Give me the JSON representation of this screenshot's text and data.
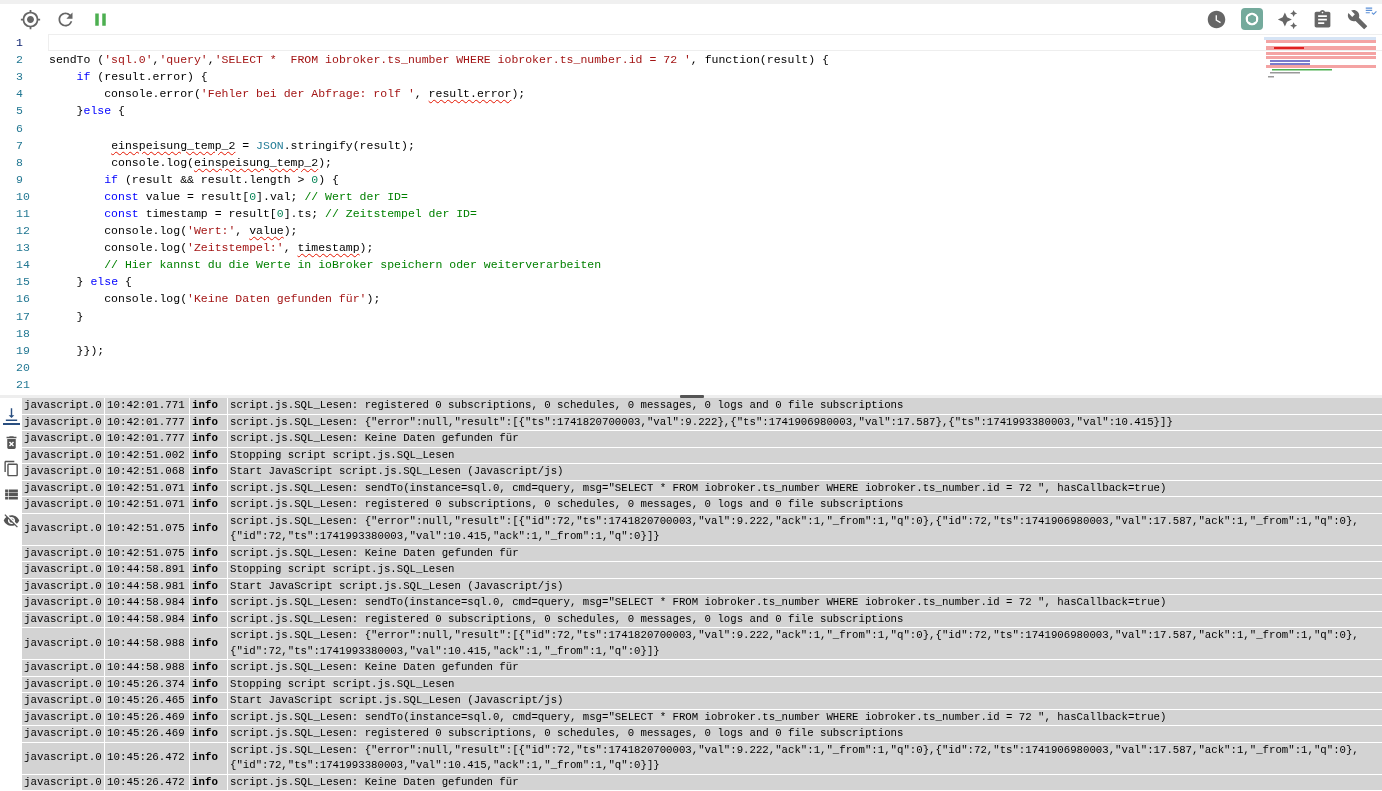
{
  "editor": {
    "lines": [
      {
        "number": "1",
        "current": true
      },
      {
        "number": "2",
        "current": false,
        "tokens": [
          {
            "kind": "plain",
            "text": "sendTo ("
          },
          {
            "kind": "str",
            "text": "'sql.0'"
          },
          {
            "kind": "plain",
            "text": ","
          },
          {
            "kind": "str",
            "text": "'query'"
          },
          {
            "kind": "plain",
            "text": ","
          },
          {
            "kind": "str",
            "text": "'SELECT *  FROM iobroker.ts_number WHERE iobroker.ts_number.id = 72 '"
          },
          {
            "kind": "plain",
            "text": ", function(result) {"
          }
        ]
      },
      {
        "number": "3",
        "current": false,
        "tokens": [
          {
            "kind": "kw",
            "text": "    if"
          },
          {
            "kind": "plain",
            "text": " (result.error) {"
          }
        ]
      },
      {
        "number": "4",
        "current": false,
        "tokens": [
          {
            "kind": "plain",
            "text": "        console.error("
          },
          {
            "kind": "str",
            "text": "'Fehler bei der Abfrage: rolf '"
          },
          {
            "kind": "plain",
            "text": ", "
          },
          {
            "kind": "plain",
            "text": "result.error",
            "misspelled": true
          },
          {
            "kind": "plain",
            "text": ");"
          }
        ]
      },
      {
        "number": "5",
        "current": false,
        "tokens": [
          {
            "kind": "plain",
            "text": "    }"
          },
          {
            "kind": "kw",
            "text": "else"
          },
          {
            "kind": "plain",
            "text": " {"
          }
        ]
      },
      {
        "number": "6",
        "current": false
      },
      {
        "number": "7",
        "current": false,
        "tokens": [
          {
            "kind": "plain",
            "text": "         einspeisung_temp_2",
            "misspelled": true
          },
          {
            "kind": "plain",
            "text": " = "
          },
          {
            "kind": "builtin",
            "text": "JSON"
          },
          {
            "kind": "plain",
            "text": ".stringify(result);"
          }
        ]
      },
      {
        "number": "8",
        "current": false,
        "tokens": [
          {
            "kind": "plain",
            "text": "         console.log("
          },
          {
            "kind": "plain",
            "text": "einspeisung_temp_2",
            "misspelled": true
          },
          {
            "kind": "plain",
            "text": ");"
          }
        ]
      },
      {
        "number": "9",
        "current": false,
        "tokens": [
          {
            "kind": "kw",
            "text": "        if"
          },
          {
            "kind": "plain",
            "text": " (result && result.length > "
          },
          {
            "kind": "num",
            "text": "0"
          },
          {
            "kind": "plain",
            "text": ") {"
          }
        ]
      },
      {
        "number": "10",
        "current": false,
        "tokens": [
          {
            "kind": "kw",
            "text": "        const"
          },
          {
            "kind": "plain",
            "text": " value = result["
          },
          {
            "kind": "num",
            "text": "0"
          },
          {
            "kind": "plain",
            "text": "].val; "
          },
          {
            "kind": "comment",
            "text": "// Wert der ID="
          }
        ]
      },
      {
        "number": "11",
        "current": false,
        "tokens": [
          {
            "kind": "kw",
            "text": "        const"
          },
          {
            "kind": "plain",
            "text": " timestamp = result["
          },
          {
            "kind": "num",
            "text": "0"
          },
          {
            "kind": "plain",
            "text": "].ts; "
          },
          {
            "kind": "comment",
            "text": "// Zeitstempel der ID="
          }
        ]
      },
      {
        "number": "12",
        "current": false,
        "tokens": [
          {
            "kind": "plain",
            "text": "        console.log("
          },
          {
            "kind": "str",
            "text": "'Wert:'"
          },
          {
            "kind": "plain",
            "text": ", "
          },
          {
            "kind": "plain",
            "text": "value",
            "misspelled": true
          },
          {
            "kind": "plain",
            "text": ");"
          }
        ]
      },
      {
        "number": "13",
        "current": false,
        "tokens": [
          {
            "kind": "plain",
            "text": "        console.log("
          },
          {
            "kind": "str",
            "text": "'Zeitstempel:'"
          },
          {
            "kind": "plain",
            "text": ", "
          },
          {
            "kind": "plain",
            "text": "timestamp",
            "misspelled": true
          },
          {
            "kind": "plain",
            "text": ");"
          }
        ]
      },
      {
        "number": "14",
        "current": false,
        "tokens": [
          {
            "kind": "comment",
            "text": "        // Hier kannst du die Werte in ioBroker speichern oder weiterverarbeiten"
          }
        ]
      },
      {
        "number": "15",
        "current": false,
        "tokens": [
          {
            "kind": "plain",
            "text": "    } "
          },
          {
            "kind": "kw",
            "text": "else"
          },
          {
            "kind": "plain",
            "text": " {"
          }
        ]
      },
      {
        "number": "16",
        "current": false,
        "tokens": [
          {
            "kind": "plain",
            "text": "        console.log("
          },
          {
            "kind": "str",
            "text": "'Keine Daten gefunden für'"
          },
          {
            "kind": "plain",
            "text": ");"
          }
        ]
      },
      {
        "number": "17",
        "current": false,
        "tokens": [
          {
            "kind": "plain",
            "text": "    }"
          }
        ]
      },
      {
        "number": "18",
        "current": false
      },
      {
        "number": "19",
        "current": false,
        "tokens": [
          {
            "kind": "plain",
            "text": "    }});"
          }
        ]
      },
      {
        "number": "20",
        "current": false
      },
      {
        "number": "21",
        "current": false
      }
    ]
  },
  "log": {
    "rows": [
      {
        "source": "javascript.0",
        "time": "10:42:01.771",
        "level": "info",
        "message": "script.js.SQL_Lesen: registered 0 subscriptions, 0 schedules, 0 messages, 0 logs and 0 file subscriptions"
      },
      {
        "source": "javascript.0",
        "time": "10:42:01.777",
        "level": "info",
        "message": "script.js.SQL_Lesen: {\"error\":null,\"result\":[{\"ts\":1741820700003,\"val\":9.222},{\"ts\":1741906980003,\"val\":17.587},{\"ts\":1741993380003,\"val\":10.415}]}"
      },
      {
        "source": "javascript.0",
        "time": "10:42:01.777",
        "level": "info",
        "message": "script.js.SQL_Lesen: Keine Daten gefunden für"
      },
      {
        "source": "javascript.0",
        "time": "10:42:51.002",
        "level": "info",
        "message": "Stopping script script.js.SQL_Lesen"
      },
      {
        "source": "javascript.0",
        "time": "10:42:51.068",
        "level": "info",
        "message": "Start JavaScript script.js.SQL_Lesen (Javascript/js)"
      },
      {
        "source": "javascript.0",
        "time": "10:42:51.071",
        "level": "info",
        "message": "script.js.SQL_Lesen: sendTo(instance=sql.0, cmd=query, msg=\"SELECT * FROM iobroker.ts_number WHERE iobroker.ts_number.id = 72 \", hasCallback=true)"
      },
      {
        "source": "javascript.0",
        "time": "10:42:51.071",
        "level": "info",
        "message": "script.js.SQL_Lesen: registered 0 subscriptions, 0 schedules, 0 messages, 0 logs and 0 file subscriptions"
      },
      {
        "source": "javascript.0",
        "time": "10:42:51.075",
        "level": "info",
        "message": "script.js.SQL_Lesen: {\"error\":null,\"result\":[{\"id\":72,\"ts\":1741820700003,\"val\":9.222,\"ack\":1,\"_from\":1,\"q\":0},{\"id\":72,\"ts\":1741906980003,\"val\":17.587,\"ack\":1,\"_from\":1,\"q\":0},{\"id\":72,\"ts\":1741993380003,\"val\":10.415,\"ack\":1,\"_from\":1,\"q\":0}]}"
      },
      {
        "source": "javascript.0",
        "time": "10:42:51.075",
        "level": "info",
        "message": "script.js.SQL_Lesen: Keine Daten gefunden für"
      },
      {
        "source": "javascript.0",
        "time": "10:44:58.891",
        "level": "info",
        "message": "Stopping script script.js.SQL_Lesen"
      },
      {
        "source": "javascript.0",
        "time": "10:44:58.981",
        "level": "info",
        "message": "Start JavaScript script.js.SQL_Lesen (Javascript/js)"
      },
      {
        "source": "javascript.0",
        "time": "10:44:58.984",
        "level": "info",
        "message": "script.js.SQL_Lesen: sendTo(instance=sql.0, cmd=query, msg=\"SELECT * FROM iobroker.ts_number WHERE iobroker.ts_number.id = 72 \", hasCallback=true)"
      },
      {
        "source": "javascript.0",
        "time": "10:44:58.984",
        "level": "info",
        "message": "script.js.SQL_Lesen: registered 0 subscriptions, 0 schedules, 0 messages, 0 logs and 0 file subscriptions"
      },
      {
        "source": "javascript.0",
        "time": "10:44:58.988",
        "level": "info",
        "message": "script.js.SQL_Lesen: {\"error\":null,\"result\":[{\"id\":72,\"ts\":1741820700003,\"val\":9.222,\"ack\":1,\"_from\":1,\"q\":0},{\"id\":72,\"ts\":1741906980003,\"val\":17.587,\"ack\":1,\"_from\":1,\"q\":0},{\"id\":72,\"ts\":1741993380003,\"val\":10.415,\"ack\":1,\"_from\":1,\"q\":0}]}"
      },
      {
        "source": "javascript.0",
        "time": "10:44:58.988",
        "level": "info",
        "message": "script.js.SQL_Lesen: Keine Daten gefunden für"
      },
      {
        "source": "javascript.0",
        "time": "10:45:26.374",
        "level": "info",
        "message": "Stopping script script.js.SQL_Lesen"
      },
      {
        "source": "javascript.0",
        "time": "10:45:26.465",
        "level": "info",
        "message": "Start JavaScript script.js.SQL_Lesen (Javascript/js)"
      },
      {
        "source": "javascript.0",
        "time": "10:45:26.469",
        "level": "info",
        "message": "script.js.SQL_Lesen: sendTo(instance=sql.0, cmd=query, msg=\"SELECT * FROM iobroker.ts_number WHERE iobroker.ts_number.id = 72 \", hasCallback=true)"
      },
      {
        "source": "javascript.0",
        "time": "10:45:26.469",
        "level": "info",
        "message": "script.js.SQL_Lesen: registered 0 subscriptions, 0 schedules, 0 messages, 0 logs and 0 file subscriptions"
      },
      {
        "source": "javascript.0",
        "time": "10:45:26.472",
        "level": "info",
        "message": "script.js.SQL_Lesen: {\"error\":null,\"result\":[{\"id\":72,\"ts\":1741820700003,\"val\":9.222,\"ack\":1,\"_from\":1,\"q\":0},{\"id\":72,\"ts\":1741906980003,\"val\":17.587,\"ack\":1,\"_from\":1,\"q\":0},{\"id\":72,\"ts\":1741993380003,\"val\":10.415,\"ack\":1,\"_from\":1,\"q\":0}]}"
      },
      {
        "source": "javascript.0",
        "time": "10:45:26.472",
        "level": "info",
        "message": "script.js.SQL_Lesen: Keine Daten gefunden für"
      }
    ]
  }
}
